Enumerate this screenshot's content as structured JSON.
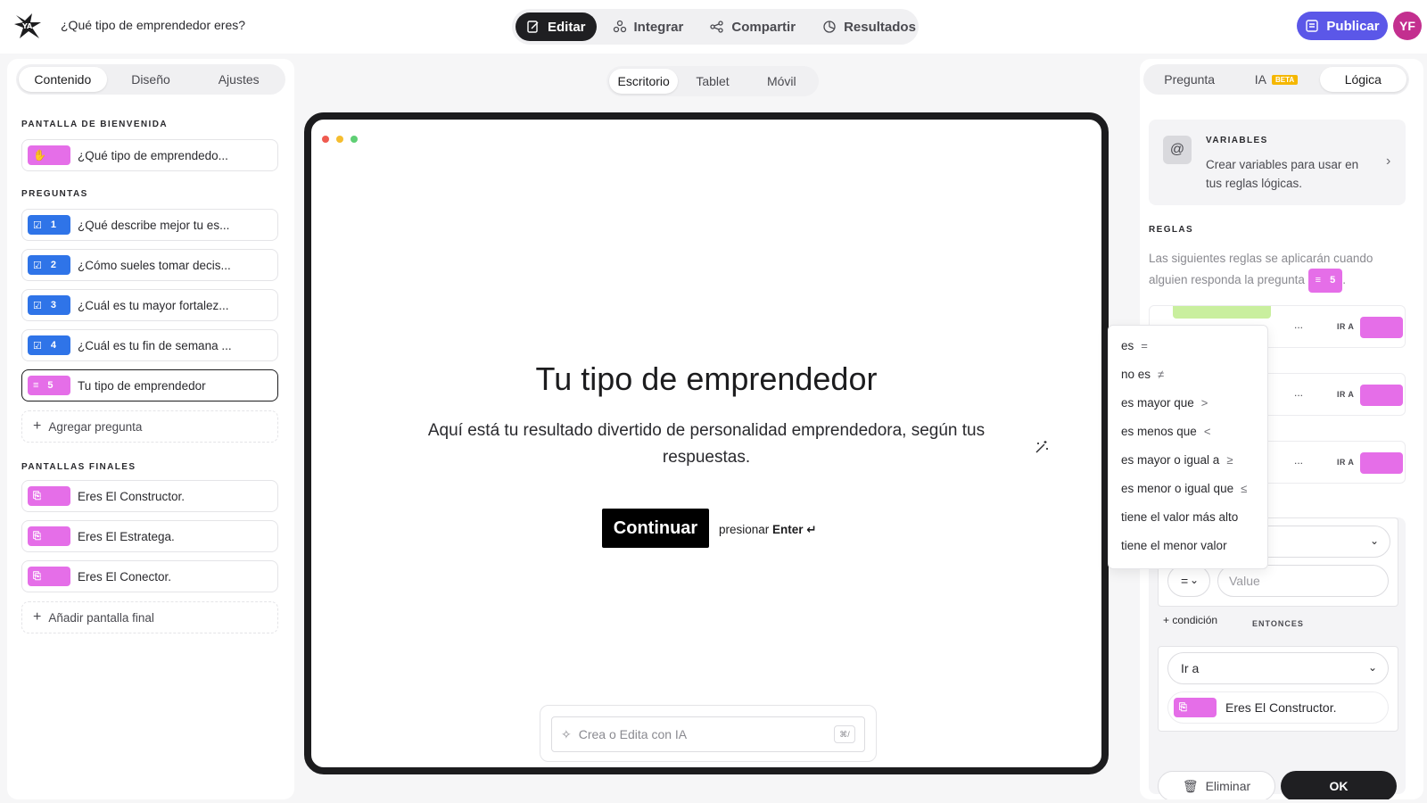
{
  "header": {
    "form_title": "¿Qué tipo de emprendedor eres?",
    "modes": [
      "Editar",
      "Integrar",
      "Compartir",
      "Resultados"
    ],
    "publish_label": "Publicar",
    "avatar_initials": "YF"
  },
  "left": {
    "tabs": [
      "Contenido",
      "Diseño",
      "Ajustes"
    ],
    "welcome_label": "PANTALLA DE BIENVENIDA",
    "welcome_item": "¿Qué tipo de emprendedo...",
    "questions_label": "PREGUNTAS",
    "questions": [
      {
        "num": "1",
        "text": "¿Qué describe mejor tu es..."
      },
      {
        "num": "2",
        "text": "¿Cómo sueles tomar decis..."
      },
      {
        "num": "3",
        "text": "¿Cuál es tu mayor fortalez..."
      },
      {
        "num": "4",
        "text": "¿Cuál es tu fin de semana ..."
      },
      {
        "num": "5",
        "text": "Tu tipo de emprendedor"
      }
    ],
    "add_question": "Agregar pregunta",
    "endings_label": "PANTALLAS FINALES",
    "endings": [
      "Eres El Constructor.",
      "Eres El Estratega.",
      "Eres El Conector."
    ],
    "add_ending": "Añadir pantalla final"
  },
  "center": {
    "devices": [
      "Escritorio",
      "Tablet",
      "Móvil"
    ],
    "title": "Tu tipo de emprendedor",
    "subtitle": "Aquí está tu resultado divertido de personalidad emprendedora, según tus respuestas.",
    "continue_label": "Continuar",
    "press_hint_prefix": "presionar",
    "press_hint_key": "Enter ↵",
    "ai_placeholder": "Crea o Edita con IA",
    "ai_shortcut": "⌘/"
  },
  "dropdown": {
    "options": [
      {
        "label": "es",
        "sym": "="
      },
      {
        "label": "no es",
        "sym": "≠"
      },
      {
        "label": "es mayor que",
        "sym": ">"
      },
      {
        "label": "es menos que",
        "sym": "<"
      },
      {
        "label": "es mayor o igual a",
        "sym": "≥"
      },
      {
        "label": "es menor o igual que",
        "sym": "≤"
      },
      {
        "label": "tiene el valor más alto",
        "sym": ""
      },
      {
        "label": "tiene el menor valor",
        "sym": ""
      }
    ]
  },
  "right": {
    "tabs": [
      "Pregunta",
      "IA",
      "Lógica"
    ],
    "beta": "BETA",
    "variables_title": "VARIABLES",
    "variables_desc": "Crear variables para usar en tus reglas lógicas.",
    "rules_label": "REGLAS",
    "rules_desc": "Las siguientes reglas se aplicarán cuando alguien responda la pregunta",
    "rules_badge_num": "5",
    "rule_dots": "...",
    "ir_a": "IR A",
    "operator_value": "=",
    "value_placeholder": "Value",
    "add_condition": "+ condición",
    "then_label": "ENTONCES",
    "action_value": "Ir a",
    "target_value": "Eres El Constructor.",
    "delete_label": "Eliminar",
    "ok_label": "OK"
  },
  "colors": {
    "accent": "#5b57e8",
    "question_badge": "#2f74e8",
    "ending_badge": "#e56ee8",
    "avatar": "#c32f8f",
    "beta": "#f5b700"
  }
}
